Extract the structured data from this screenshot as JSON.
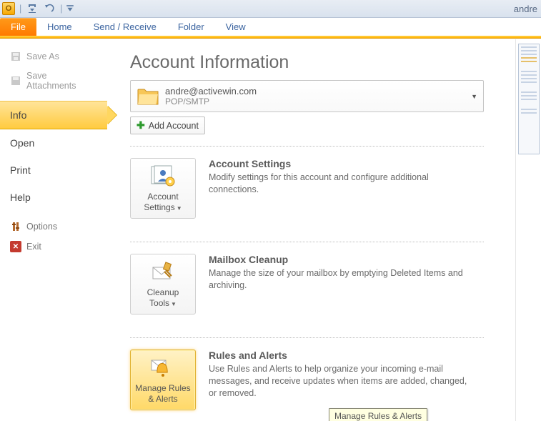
{
  "title_right": "andre",
  "tabs": {
    "file": "File",
    "home": "Home",
    "sendrecv": "Send / Receive",
    "folder": "Folder",
    "view": "View"
  },
  "nav": {
    "save_as": "Save As",
    "save_attachments": "Save Attachments",
    "info": "Info",
    "open": "Open",
    "print": "Print",
    "help": "Help",
    "options": "Options",
    "exit": "Exit"
  },
  "page_title": "Account Information",
  "account": {
    "email": "andre@activewin.com",
    "protocol": "POP/SMTP"
  },
  "add_account": "Add Account",
  "sections": {
    "settings": {
      "button_line1": "Account",
      "button_line2": "Settings",
      "title": "Account Settings",
      "desc": "Modify settings for this account and configure additional connections."
    },
    "cleanup": {
      "button_line1": "Cleanup",
      "button_line2": "Tools",
      "title": "Mailbox Cleanup",
      "desc": "Manage the size of your mailbox by emptying Deleted Items and archiving."
    },
    "rules": {
      "button_line1": "Manage Rules",
      "button_line2": "& Alerts",
      "title": "Rules and Alerts",
      "desc": "Use Rules and Alerts to help organize your incoming e-mail messages, and receive updates when items are added, changed, or removed."
    }
  },
  "tooltip": "Manage Rules & Alerts"
}
